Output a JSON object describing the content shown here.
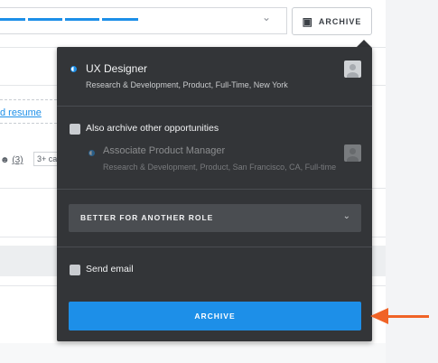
{
  "toolbar": {
    "archive_label": "ARCHIVE",
    "archive_icon": "archive-box-icon",
    "stage_dropdown_icon": "chevron-down-icon"
  },
  "background": {
    "resume_link": "d resume",
    "referral_count": "(3)",
    "more_chip": "3+ ca",
    "people_icon": "people-icon"
  },
  "popover": {
    "current_opportunity": {
      "title": "UX Designer",
      "subtitle": "Research & Development, Product, Full-Time, New York"
    },
    "also_archive_label": "Also archive other opportunities",
    "other_opportunity": {
      "title": "Associate Product Manager",
      "subtitle": "Research & Development, Product, San Francisco, CA, Full-time"
    },
    "reason_select": {
      "value": "BETTER FOR ANOTHER ROLE"
    },
    "send_email_label": "Send email",
    "submit_label": "ARCHIVE"
  },
  "colors": {
    "accent": "#1d8fe8",
    "popover_bg": "#333538",
    "annotation_arrow": "#f06327"
  }
}
